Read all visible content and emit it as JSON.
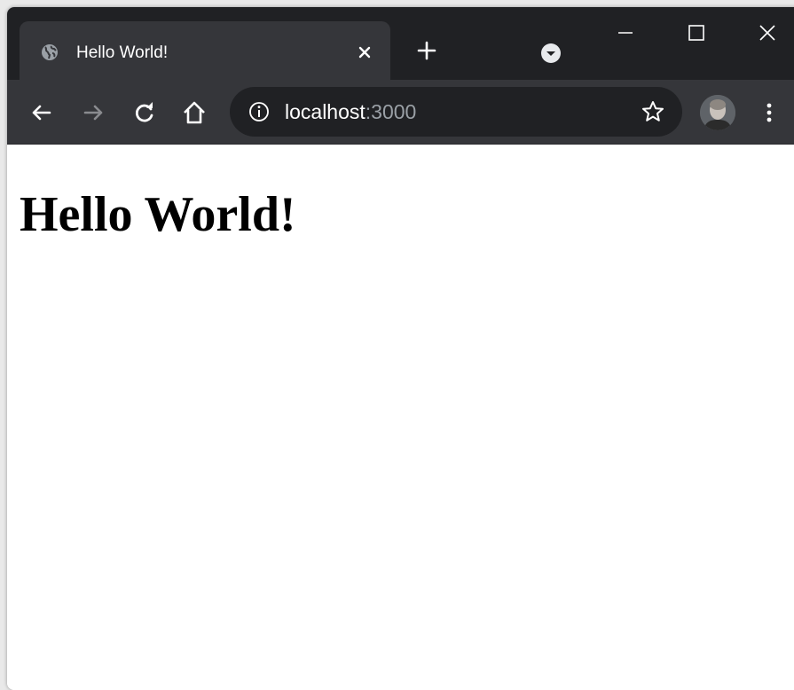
{
  "tab": {
    "title": "Hello World!",
    "favicon": "globe-icon"
  },
  "toolbar": {
    "back_icon": "arrow-left-icon",
    "forward_icon": "arrow-right-icon",
    "reload_icon": "reload-icon",
    "home_icon": "home-icon",
    "info_icon": "info-icon",
    "bookmark_icon": "star-icon",
    "menu_icon": "more-vertical-icon"
  },
  "address": {
    "host": "localhost",
    "port": ":3000"
  },
  "page": {
    "heading": "Hello World!"
  },
  "theme": {
    "titlebar": "#202124",
    "tab_active": "#35363a",
    "text": "#ffffff",
    "muted_text": "#9aa0a6"
  }
}
